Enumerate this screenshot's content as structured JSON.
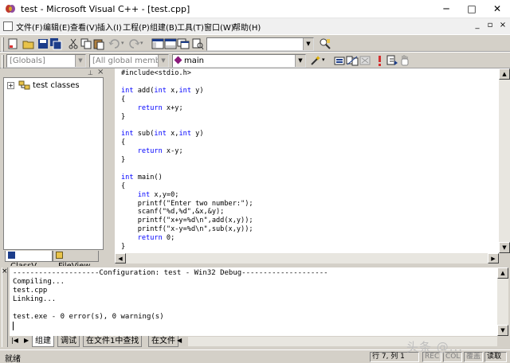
{
  "window": {
    "title": "test - Microsoft Visual C++ - [test.cpp]",
    "minimize_glyph": "─",
    "maximize_glyph": "□",
    "close_glyph": "✕"
  },
  "menu": {
    "items": [
      "文件(F)",
      "编辑(E)",
      "查看(V)",
      "插入(I)",
      "工程(P)",
      "组建(B)",
      "工具(T)",
      "窗口(W)",
      "帮助(H)"
    ],
    "mdi_min": "_",
    "mdi_restore": "▫",
    "mdi_close": "×"
  },
  "toolbar": {
    "find_combo_value": ""
  },
  "wizardbar": {
    "class_combo": "[Globals]",
    "filter_combo": "[All global members",
    "member_combo": "main"
  },
  "workspace": {
    "tree_root": "test classes",
    "expander": "+",
    "tabs": [
      "ClassV...",
      "FileView"
    ]
  },
  "editor": {
    "lines": [
      {
        "text": "#include<stdio.h>",
        "kw": ""
      },
      {
        "text": "",
        "kw": ""
      },
      {
        "text": " add(",
        "kw": "int",
        "rest": [
          {
            "kw": "int",
            "t": " x,"
          },
          {
            "kw": "int",
            "t": " y)"
          }
        ]
      },
      {
        "text": "{",
        "kw": ""
      },
      {
        "text": " x+y;",
        "kw": "    return"
      },
      {
        "text": "}",
        "kw": ""
      },
      {
        "text": "",
        "kw": ""
      },
      {
        "text": " sub(",
        "kw": "int",
        "rest": [
          {
            "kw": "int",
            "t": " x,"
          },
          {
            "kw": "int",
            "t": " y)"
          }
        ]
      },
      {
        "text": "{",
        "kw": ""
      },
      {
        "text": " x-y;",
        "kw": "    return"
      },
      {
        "text": "}",
        "kw": ""
      },
      {
        "text": "",
        "kw": ""
      },
      {
        "text": " main()",
        "kw": "int"
      },
      {
        "text": "{",
        "kw": ""
      },
      {
        "text": " x,y=0;",
        "kw": "    int"
      },
      {
        "text": "    printf(\"Enter two number:\");",
        "kw": ""
      },
      {
        "text": "    scanf(\"%d,%d\",&x,&y);",
        "kw": ""
      },
      {
        "text": "    printf(\"x+y=%d\\n\",add(x,y));",
        "kw": ""
      },
      {
        "text": "    printf(\"x-y=%d\\n\",sub(x,y));",
        "kw": ""
      },
      {
        "text": " 0;",
        "kw": "    return"
      },
      {
        "text": "}",
        "kw": ""
      }
    ]
  },
  "output": {
    "lines": [
      "--------------------Configuration: test - Win32 Debug--------------------",
      "Compiling...",
      "test.cpp",
      "Linking...",
      "",
      "test.exe - 0 error(s), 0 warning(s)"
    ],
    "tabs": [
      "组建",
      "调试",
      "在文件1中查找",
      "在文件"
    ]
  },
  "statusbar": {
    "ready": "就绪",
    "position": "行 7, 列 1",
    "rec": "REC",
    "col": "COL",
    "ovr": "覆盖",
    "read": "读取"
  },
  "watermark": "头条 @...",
  "colors": {
    "keyword": "#0000ff",
    "chrome": "#d4d0c8",
    "editor_bg": "#ffffff"
  }
}
